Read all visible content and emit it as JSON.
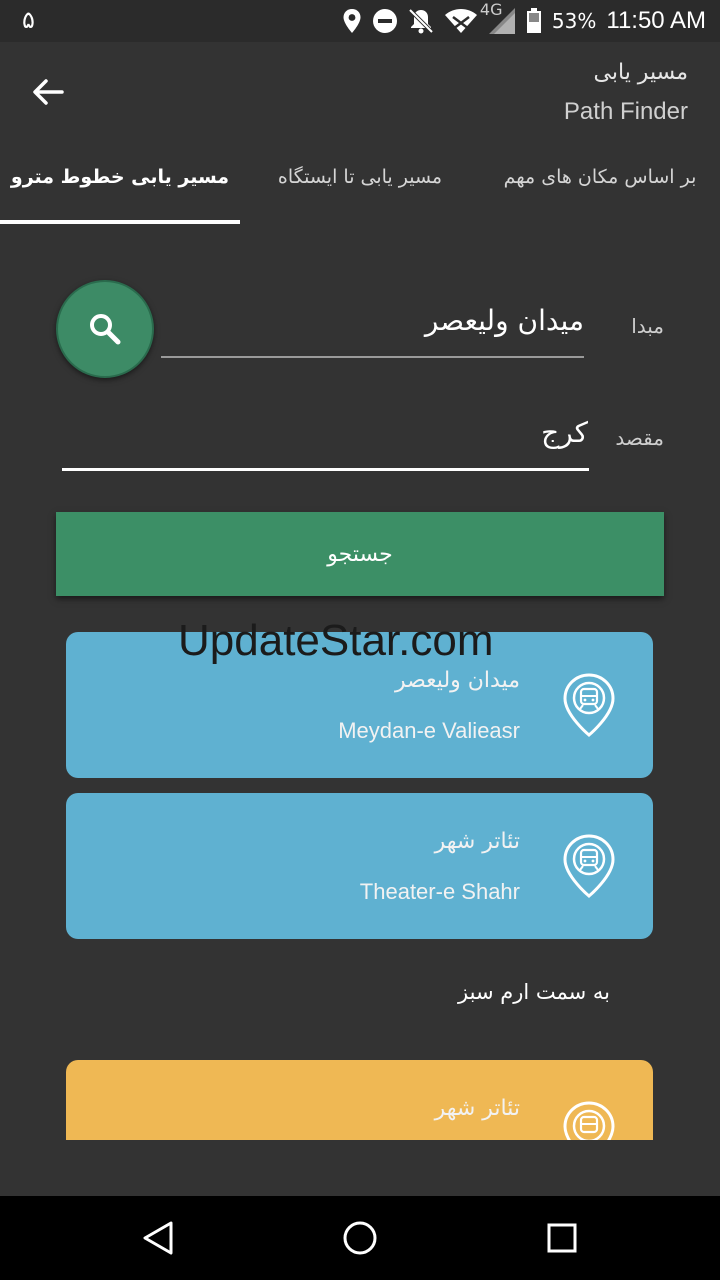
{
  "status_bar": {
    "notification_digit": "۵",
    "network": "4G",
    "battery": "53%",
    "time": "11:50 AM",
    "icons": [
      "location-icon",
      "do-not-disturb-icon",
      "notifications-off-icon",
      "wifi-icon",
      "signal-icon",
      "battery-icon"
    ]
  },
  "toolbar": {
    "title_fa": "مسیر یابی",
    "title_en": "Path Finder",
    "back_icon": "arrow-left-icon"
  },
  "tabs": [
    {
      "label": "مسیر یابی خطوط مترو",
      "active": true
    },
    {
      "label": "مسیر یابی تا ایستگاه",
      "active": false
    },
    {
      "label": "بر اساس مکان های مهم",
      "active": false
    }
  ],
  "form": {
    "origin_label": "مبدا",
    "origin_value": "میدان ولیعصر",
    "destination_label": "مقصد",
    "destination_value": "کرج",
    "search_button": "جستجو"
  },
  "watermark": "UpdateStar.com",
  "stations": [
    {
      "name_fa": "میدان ولیعصر",
      "name_en": "Meydan-e Valieasr",
      "color": "#5fb1d1"
    },
    {
      "name_fa": "تئاتر شهر",
      "name_en": "Theater-e Shahr",
      "color": "#5fb1d1"
    }
  ],
  "direction_text": "به سمت ارم سبز",
  "next_station": {
    "name_fa": "تئاتر شهر",
    "color": "#efb854"
  },
  "colors": {
    "accent_green": "#3c8f66",
    "background": "#333333"
  }
}
